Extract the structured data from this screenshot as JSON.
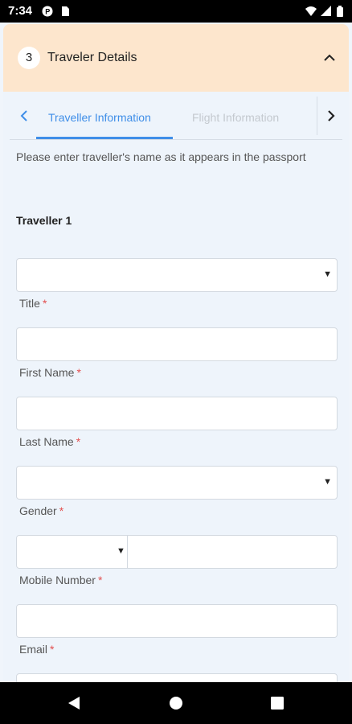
{
  "status_bar": {
    "time": "7:34",
    "left_icons": [
      "p-circle-icon",
      "sim-card-icon"
    ],
    "right_icons": [
      "wifi-icon",
      "signal-icon",
      "battery-icon"
    ]
  },
  "section": {
    "step_number": "3",
    "title": "Traveler Details",
    "header_color": "#fde6cd"
  },
  "tabs": {
    "items": [
      {
        "label": "Traveller Information",
        "active": true
      },
      {
        "label": "Flight Information",
        "active": false
      }
    ],
    "accent_color": "#3f8ee8"
  },
  "form": {
    "instructions": "Please enter traveller's name as it appears in the passport",
    "traveller_heading": "Traveller 1",
    "required_marker": "*",
    "fields": [
      {
        "label": "Title",
        "value": "",
        "type": "select"
      },
      {
        "label": "First Name",
        "value": "",
        "type": "text"
      },
      {
        "label": "Last Name",
        "value": "",
        "type": "text"
      },
      {
        "label": "Gender",
        "value": "",
        "type": "select"
      },
      {
        "label": "Mobile Number",
        "value": "",
        "type": "phone",
        "country_code": ""
      },
      {
        "label": "Email",
        "value": "",
        "type": "text"
      }
    ]
  },
  "nav_bar": {
    "buttons": [
      "back-icon",
      "home-icon",
      "recents-icon"
    ]
  }
}
